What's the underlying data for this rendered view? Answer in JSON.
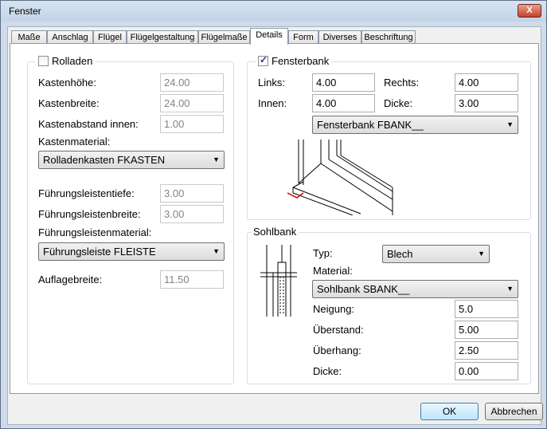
{
  "window": {
    "title": "Fenster",
    "close_symbol": "X"
  },
  "tabs": [
    "Maße",
    "Anschlag",
    "Flügel",
    "Flügelgestaltung",
    "Flügelmaße",
    "Details",
    "Form",
    "Diverses",
    "Beschriftung"
  ],
  "active_tab": "Details",
  "rolladen": {
    "title": "Rolladen",
    "checked": false,
    "kastenhoehe_label": "Kastenhöhe:",
    "kastenhoehe": "24.00",
    "kastenbreite_label": "Kastenbreite:",
    "kastenbreite": "24.00",
    "kastenabstand_label": "Kastenabstand innen:",
    "kastenabstand": "1.00",
    "kastenmaterial_label": "Kastenmaterial:",
    "kastenmaterial": "Rolladenkasten FKASTEN",
    "fuehrungstiefe_label": "Führungsleistentiefe:",
    "fuehrungstiefe": "3.00",
    "fuehrungsbreite_label": "Führungsleistenbreite:",
    "fuehrungsbreite": "3.00",
    "fuehrungsmaterial_label": "Führungsleistenmaterial:",
    "fuehrungsmaterial": "Führungsleiste FLEISTE",
    "auflagebreite_label": "Auflagebreite:",
    "auflagebreite": "11.50"
  },
  "fensterbank": {
    "title": "Fensterbank",
    "checked": true,
    "links_label": "Links:",
    "links": "4.00",
    "rechts_label": "Rechts:",
    "rechts": "4.00",
    "innen_label": "Innen:",
    "innen": "4.00",
    "dicke_label": "Dicke:",
    "dicke": "3.00",
    "material": "Fensterbank FBANK__"
  },
  "sohlbank": {
    "title": "Sohlbank",
    "typ_label": "Typ:",
    "typ": "Blech",
    "material_label": "Material:",
    "material": "Sohlbank SBANK__",
    "neigung_label": "Neigung:",
    "neigung": "5.0",
    "ueberstand_label": "Überstand:",
    "ueberstand": "5.00",
    "ueberhang_label": "Überhang:",
    "ueberhang": "2.50",
    "dicke_label": "Dicke:",
    "dicke": "0.00"
  },
  "buttons": {
    "ok": "OK",
    "cancel": "Abbrechen"
  }
}
